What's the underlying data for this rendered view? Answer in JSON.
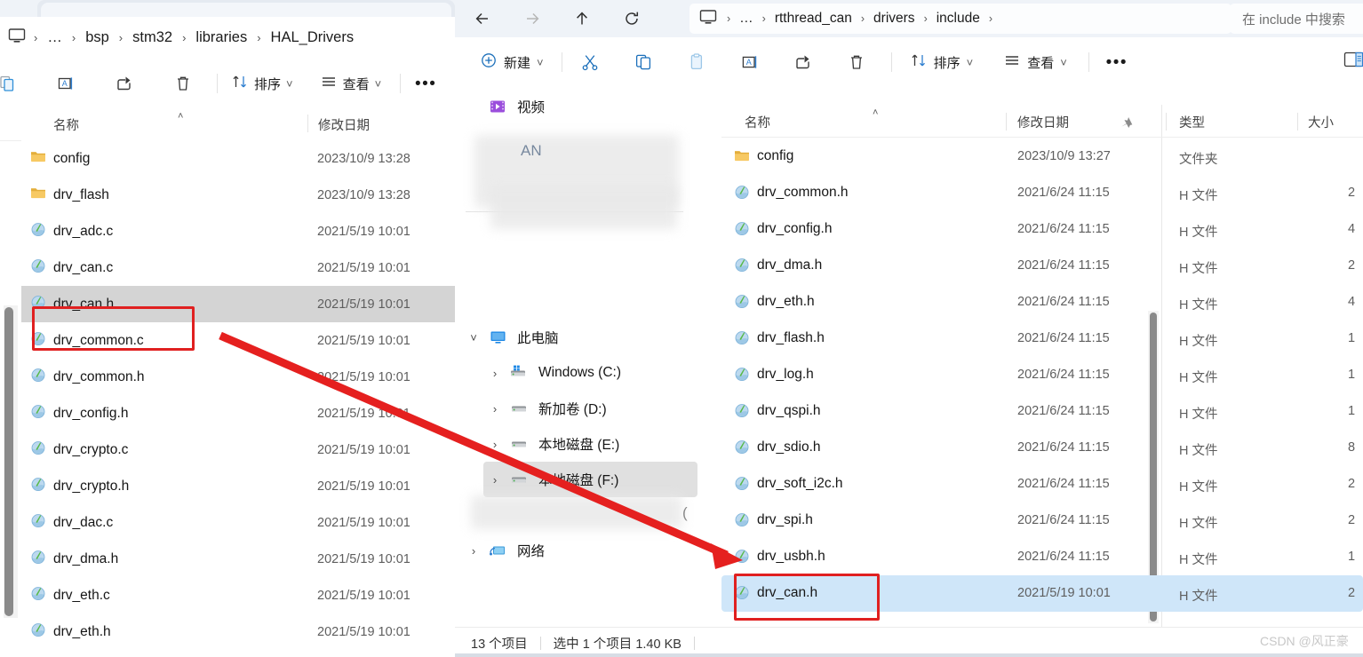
{
  "left_window": {
    "breadcrumb": {
      "home_icon": "this-pc-icon",
      "items": [
        "…",
        "bsp",
        "stm32",
        "libraries",
        "HAL_Drivers"
      ],
      "separator": "›"
    },
    "toolbar": {
      "paste_icon": "paste-icon",
      "rename_icon": "rename-icon",
      "share_icon": "share-icon",
      "delete_icon": "delete-icon",
      "sort_label": "排序",
      "sort_icon": "sort-icon",
      "view_label": "查看",
      "view_icon": "view-icon",
      "more_label": "•••"
    },
    "columns": {
      "name": "名称",
      "date": "修改日期"
    },
    "files": [
      {
        "name": "config",
        "date": "2023/10/9 13:28",
        "icon": "folder-icon",
        "selected": false
      },
      {
        "name": "drv_flash",
        "date": "2023/10/9 13:28",
        "icon": "folder-icon",
        "selected": false
      },
      {
        "name": "drv_adc.c",
        "date": "2021/5/19 10:01",
        "icon": "source-file-icon",
        "selected": false
      },
      {
        "name": "drv_can.c",
        "date": "2021/5/19 10:01",
        "icon": "source-file-icon",
        "selected": false
      },
      {
        "name": "drv_can.h",
        "date": "2021/5/19 10:01",
        "icon": "source-file-icon",
        "selected": true
      },
      {
        "name": "drv_common.c",
        "date": "2021/5/19 10:01",
        "icon": "source-file-icon",
        "selected": false
      },
      {
        "name": "drv_common.h",
        "date": "2021/5/19 10:01",
        "icon": "source-file-icon",
        "selected": false
      },
      {
        "name": "drv_config.h",
        "date": "2021/5/19 10:01",
        "icon": "source-file-icon",
        "selected": false
      },
      {
        "name": "drv_crypto.c",
        "date": "2021/5/19 10:01",
        "icon": "source-file-icon",
        "selected": false
      },
      {
        "name": "drv_crypto.h",
        "date": "2021/5/19 10:01",
        "icon": "source-file-icon",
        "selected": false
      },
      {
        "name": "drv_dac.c",
        "date": "2021/5/19 10:01",
        "icon": "source-file-icon",
        "selected": false
      },
      {
        "name": "drv_dma.h",
        "date": "2021/5/19 10:01",
        "icon": "source-file-icon",
        "selected": false
      },
      {
        "name": "drv_eth.c",
        "date": "2021/5/19 10:01",
        "icon": "source-file-icon",
        "selected": false
      },
      {
        "name": "drv_eth.h",
        "date": "2021/5/19 10:01",
        "icon": "source-file-icon",
        "selected": false
      }
    ]
  },
  "right_window": {
    "nav": {
      "back_icon": "back-arrow-icon",
      "forward_icon": "forward-arrow-icon",
      "up_icon": "up-arrow-icon",
      "refresh_icon": "refresh-icon"
    },
    "address": {
      "home_icon": "this-pc-icon",
      "items": [
        "…",
        "rtthread_can",
        "drivers",
        "include"
      ],
      "separator": "›"
    },
    "search": {
      "placeholder": "在 include 中搜索",
      "icon": "search-icon"
    },
    "toolbar": {
      "new_label": "新建",
      "new_icon": "plus-circle-icon",
      "cut_icon": "cut-icon",
      "copy_icon": "copy-icon",
      "paste_icon": "paste-icon",
      "rename_icon": "rename-icon",
      "share_icon": "share-icon",
      "delete_icon": "delete-icon",
      "sort_label": "排序",
      "sort_icon": "sort-icon",
      "view_label": "查看",
      "view_icon": "view-icon",
      "more_label": "•••",
      "details_pane_icon": "details-pane-icon",
      "chevron": "˅"
    },
    "sidebar": {
      "pin_icon": "pin-icon",
      "items": [
        {
          "label": "视频",
          "icon": "videos-icon",
          "expander": "",
          "selected": false,
          "indent": 0
        },
        {
          "label": "此电脑",
          "icon": "this-pc-icon",
          "expander": "˅",
          "selected": false,
          "indent": 0
        },
        {
          "label": "Windows (C:)",
          "icon": "windows-drive-icon",
          "expander": "›",
          "selected": false,
          "indent": 1
        },
        {
          "label": "新加卷 (D:)",
          "icon": "drive-icon",
          "expander": "›",
          "selected": false,
          "indent": 1
        },
        {
          "label": "本地磁盘 (E:)",
          "icon": "drive-icon",
          "expander": "›",
          "selected": false,
          "indent": 1
        },
        {
          "label": "本地磁盘 (F:)",
          "icon": "drive-icon",
          "expander": "›",
          "selected": true,
          "indent": 1
        },
        {
          "label": "网络",
          "icon": "network-icon",
          "expander": "›",
          "selected": false,
          "indent": 0
        }
      ]
    },
    "columns": {
      "name": "名称",
      "date": "修改日期",
      "type": "类型",
      "size": "大小",
      "sort_caret": "˄"
    },
    "files": [
      {
        "name": "config",
        "date": "2023/10/9 13:27",
        "type": "文件夹",
        "size": "",
        "icon": "folder-icon",
        "selected": false
      },
      {
        "name": "drv_common.h",
        "date": "2021/6/24 11:15",
        "type": "H 文件",
        "size": "2",
        "icon": "source-file-icon",
        "selected": false
      },
      {
        "name": "drv_config.h",
        "date": "2021/6/24 11:15",
        "type": "H 文件",
        "size": "4",
        "icon": "source-file-icon",
        "selected": false
      },
      {
        "name": "drv_dma.h",
        "date": "2021/6/24 11:15",
        "type": "H 文件",
        "size": "2",
        "icon": "source-file-icon",
        "selected": false
      },
      {
        "name": "drv_eth.h",
        "date": "2021/6/24 11:15",
        "type": "H 文件",
        "size": "4",
        "icon": "source-file-icon",
        "selected": false
      },
      {
        "name": "drv_flash.h",
        "date": "2021/6/24 11:15",
        "type": "H 文件",
        "size": "1",
        "icon": "source-file-icon",
        "selected": false
      },
      {
        "name": "drv_log.h",
        "date": "2021/6/24 11:15",
        "type": "H 文件",
        "size": "1",
        "icon": "source-file-icon",
        "selected": false
      },
      {
        "name": "drv_qspi.h",
        "date": "2021/6/24 11:15",
        "type": "H 文件",
        "size": "1",
        "icon": "source-file-icon",
        "selected": false
      },
      {
        "name": "drv_sdio.h",
        "date": "2021/6/24 11:15",
        "type": "H 文件",
        "size": "8",
        "icon": "source-file-icon",
        "selected": false
      },
      {
        "name": "drv_soft_i2c.h",
        "date": "2021/6/24 11:15",
        "type": "H 文件",
        "size": "2",
        "icon": "source-file-icon",
        "selected": false
      },
      {
        "name": "drv_spi.h",
        "date": "2021/6/24 11:15",
        "type": "H 文件",
        "size": "2",
        "icon": "source-file-icon",
        "selected": false
      },
      {
        "name": "drv_usbh.h",
        "date": "2021/6/24 11:15",
        "type": "H 文件",
        "size": "1",
        "icon": "source-file-icon",
        "selected": false
      },
      {
        "name": "drv_can.h",
        "date": "2021/5/19 10:01",
        "type": "H 文件",
        "size": "2",
        "icon": "source-file-icon",
        "selected": true
      }
    ],
    "statusbar": {
      "item_count": "13 个项目",
      "selection": "选中 1 个项目  1.40 KB"
    }
  },
  "annotations": {
    "watermark": "CSDN @风正豪",
    "highlight_color": "#e02020",
    "arrow_color": "#e5201f",
    "selection_color": "#cfe6f9"
  }
}
